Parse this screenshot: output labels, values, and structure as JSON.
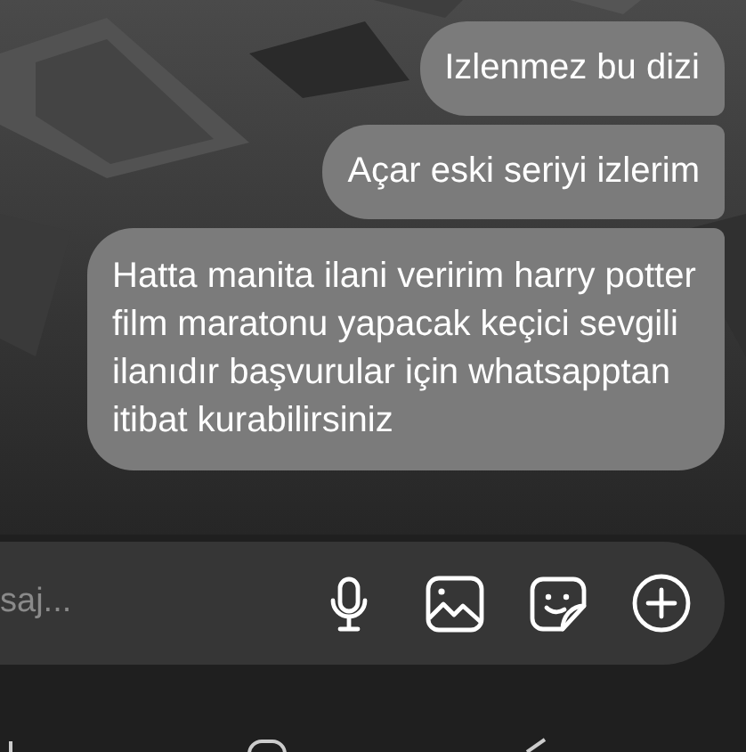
{
  "messages": [
    {
      "text": "Izlenmez bu dizi",
      "outgoing": true
    },
    {
      "text": "Açar eski seriyi izlerim",
      "outgoing": true
    },
    {
      "text": "Hatta manita ilani veririm harry potter film maratonu yapacak keçici sevgili ilanıdır başvurular için whatsapptan itibat kurabilirsiniz",
      "outgoing": true
    }
  ],
  "composer": {
    "placeholder": "saj..."
  }
}
